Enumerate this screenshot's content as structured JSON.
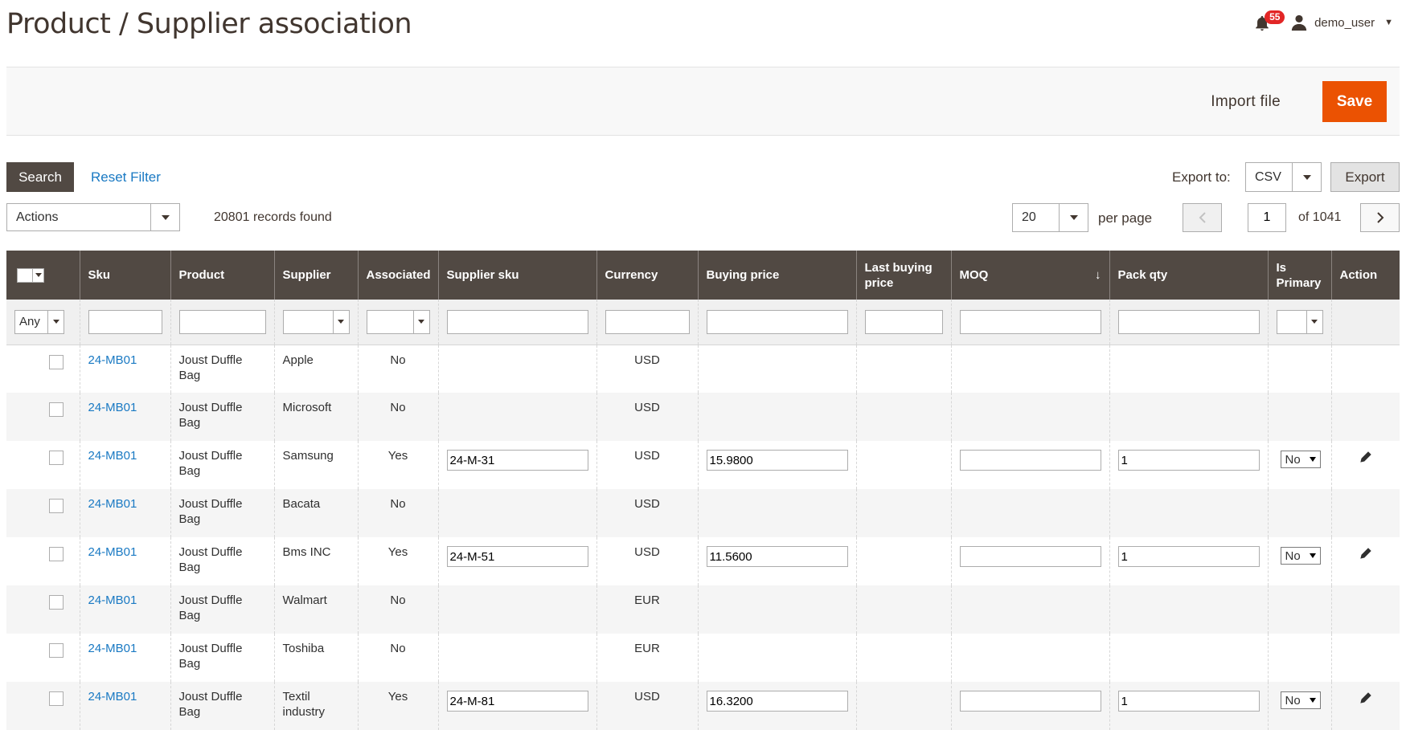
{
  "header": {
    "title": "Product / Supplier association",
    "notifications_count": "55",
    "username": "demo_user"
  },
  "page_actions": {
    "import_label": "Import file",
    "save_label": "Save"
  },
  "toolbar": {
    "search_label": "Search",
    "reset_label": "Reset Filter",
    "export_to_label": "Export to:",
    "export_format": "CSV",
    "export_label": "Export",
    "actions_label": "Actions",
    "records_found": "20801 records found",
    "per_page_value": "20",
    "per_page_label": "per page",
    "current_page": "1",
    "of_pages": "of 1041"
  },
  "colors": {
    "header_bg": "#514943",
    "accent": "#eb5202",
    "link": "#1979c3"
  },
  "grid": {
    "columns": [
      "Sku",
      "Product",
      "Supplier",
      "Associated",
      "Supplier sku",
      "Currency",
      "Buying price",
      "Last buying price",
      "MOQ",
      "Pack qty",
      "Is Primary",
      "Action"
    ],
    "filter_any": "Any",
    "rows": [
      {
        "sku": "24-MB01",
        "product": "Joust Duffle Bag",
        "supplier": "Apple",
        "associated": "No",
        "supplier_sku": "",
        "currency": "USD",
        "buying_price": "",
        "pack_qty": "",
        "is_primary": ""
      },
      {
        "sku": "24-MB01",
        "product": "Joust Duffle Bag",
        "supplier": "Microsoft",
        "associated": "No",
        "supplier_sku": "",
        "currency": "USD",
        "buying_price": "",
        "pack_qty": "",
        "is_primary": ""
      },
      {
        "sku": "24-MB01",
        "product": "Joust Duffle Bag",
        "supplier": "Samsung",
        "associated": "Yes",
        "supplier_sku": "24-M-31",
        "currency": "USD",
        "buying_price": "15.9800",
        "pack_qty": "1",
        "is_primary": "No"
      },
      {
        "sku": "24-MB01",
        "product": "Joust Duffle Bag",
        "supplier": "Bacata",
        "associated": "No",
        "supplier_sku": "",
        "currency": "USD",
        "buying_price": "",
        "pack_qty": "",
        "is_primary": ""
      },
      {
        "sku": "24-MB01",
        "product": "Joust Duffle Bag",
        "supplier": "Bms INC",
        "associated": "Yes",
        "supplier_sku": "24-M-51",
        "currency": "USD",
        "buying_price": "11.5600",
        "pack_qty": "1",
        "is_primary": "No"
      },
      {
        "sku": "24-MB01",
        "product": "Joust Duffle Bag",
        "supplier": "Walmart",
        "associated": "No",
        "supplier_sku": "",
        "currency": "EUR",
        "buying_price": "",
        "pack_qty": "",
        "is_primary": ""
      },
      {
        "sku": "24-MB01",
        "product": "Joust Duffle Bag",
        "supplier": "Toshiba",
        "associated": "No",
        "supplier_sku": "",
        "currency": "EUR",
        "buying_price": "",
        "pack_qty": "",
        "is_primary": ""
      },
      {
        "sku": "24-MB01",
        "product": "Joust Duffle Bag",
        "supplier": "Textil industry",
        "associated": "Yes",
        "supplier_sku": "24-M-81",
        "currency": "USD",
        "buying_price": "16.3200",
        "pack_qty": "1",
        "is_primary": "No"
      }
    ]
  }
}
